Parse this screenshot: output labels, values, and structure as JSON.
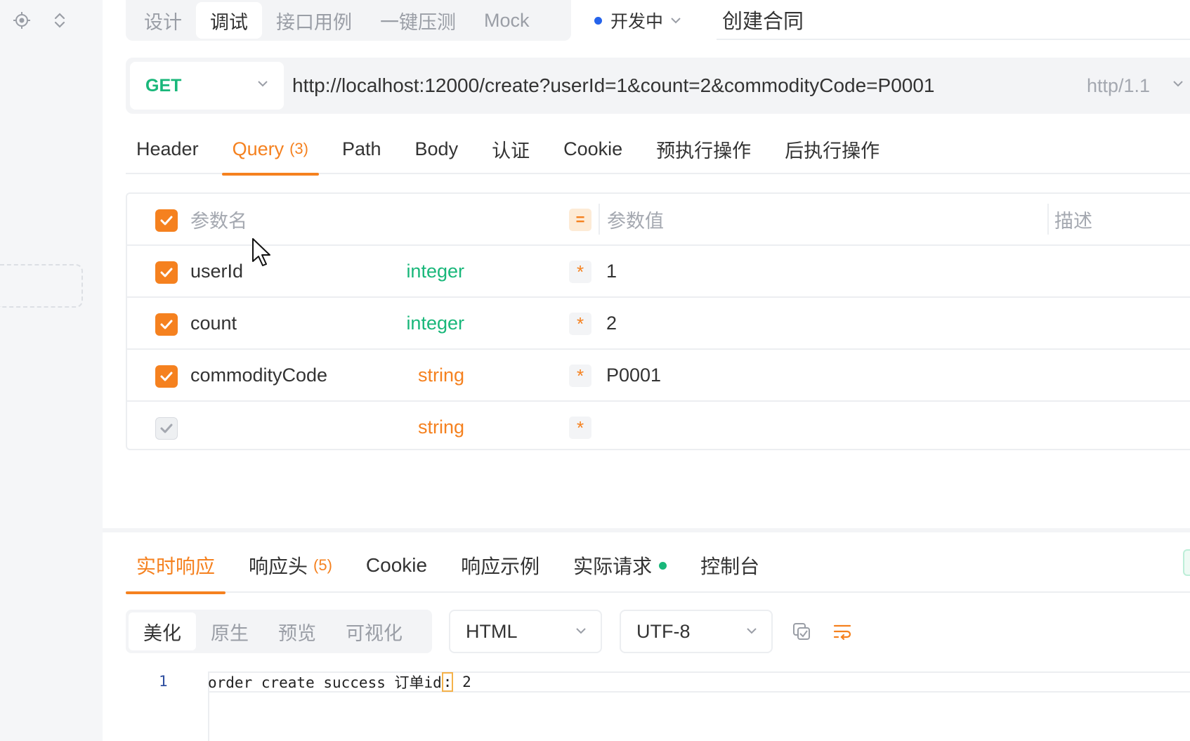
{
  "colors": {
    "accent": "#f5811f",
    "method_get": "#19b77a",
    "type_integer": "#19b77a",
    "type_string": "#f5811f",
    "status_dot": "#2563eb"
  },
  "top_tabs": [
    {
      "label": "设计",
      "active": false
    },
    {
      "label": "调试",
      "active": true
    },
    {
      "label": "接口用例",
      "active": false
    },
    {
      "label": "一键压测",
      "active": false
    },
    {
      "label": "Mock",
      "active": false
    }
  ],
  "status": {
    "label": "开发中"
  },
  "api_name": "创建合同",
  "request": {
    "method": "GET",
    "url": "http://localhost:12000/create?userId=1&count=2&commodityCode=P0001",
    "protocol": "http/1.1"
  },
  "request_tabs": [
    {
      "label": "Header"
    },
    {
      "label": "Query",
      "badge": "(3)"
    },
    {
      "label": "Path"
    },
    {
      "label": "Body"
    },
    {
      "label": "认证"
    },
    {
      "label": "Cookie"
    },
    {
      "label": "预执行操作"
    },
    {
      "label": "后执行操作"
    }
  ],
  "params_header": {
    "name": "参数名",
    "value": "参数值",
    "desc": "描述",
    "eq": "="
  },
  "params": [
    {
      "name": "userId",
      "type": "integer",
      "required": "*",
      "value": "1"
    },
    {
      "name": "count",
      "type": "integer",
      "required": "*",
      "value": "2"
    },
    {
      "name": "commodityCode",
      "type": "string",
      "required": "*",
      "value": "P0001"
    },
    {
      "name": "",
      "type": "string",
      "required": "*",
      "value": ""
    }
  ],
  "response_tabs": [
    {
      "label": "实时响应"
    },
    {
      "label": "响应头",
      "badge": "(5)"
    },
    {
      "label": "Cookie"
    },
    {
      "label": "响应示例"
    },
    {
      "label": "实际请求"
    },
    {
      "label": "控制台"
    }
  ],
  "view_tabs": [
    {
      "label": "美化"
    },
    {
      "label": "原生"
    },
    {
      "label": "预览"
    },
    {
      "label": "可视化"
    }
  ],
  "format_select": "HTML",
  "encoding_select": "UTF-8",
  "code": {
    "line_number": "1",
    "before": "order create success 订单id",
    "highlight": ":",
    "after": " 2"
  }
}
